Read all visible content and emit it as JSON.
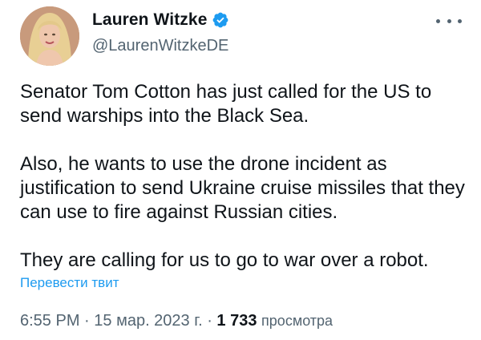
{
  "author": {
    "display_name": "Lauren Witzke",
    "handle": "@LaurenWitzkeDE",
    "verified": true,
    "avatar_icon": "profile-photo"
  },
  "tweet": {
    "paragraphs": [
      "Senator Tom Cotton has just called for the US to send warships into the Black Sea.",
      "Also, he wants to use the drone incident as justification to send Ukraine cruise missiles that they can use to fire against Russian cities.",
      "They are calling for us to go to war over a robot."
    ],
    "translate_label": "Перевести твит"
  },
  "meta": {
    "time": "6:55 PM",
    "separator": " · ",
    "date": "15 мар. 2023 г.",
    "views_count": "1 733",
    "views_label": "просмотра"
  },
  "colors": {
    "text": "#0f1419",
    "secondary": "#536471",
    "link": "#1d9bf0",
    "verified": "#1d9bf0"
  }
}
